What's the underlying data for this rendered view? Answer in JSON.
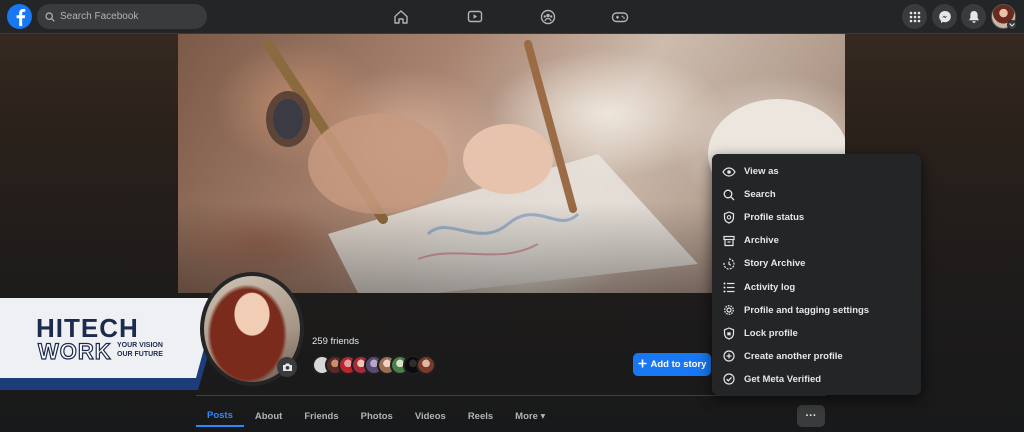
{
  "topbar": {
    "search_placeholder": "Search Facebook",
    "icons": [
      "facebook-logo",
      "search-icon",
      "home-icon",
      "video-icon",
      "groups-icon",
      "gaming-icon",
      "menu-grid-icon",
      "messenger-icon",
      "notifications-icon"
    ]
  },
  "profile": {
    "friends_count": "259 friends",
    "add_story_label": "Add to story"
  },
  "tabs": [
    {
      "label": "Posts",
      "active": true
    },
    {
      "label": "About"
    },
    {
      "label": "Friends"
    },
    {
      "label": "Photos"
    },
    {
      "label": "Videos"
    },
    {
      "label": "Reels"
    },
    {
      "label": "More ▾"
    }
  ],
  "more_button_label": "···",
  "menu": {
    "items": [
      {
        "label": "View as",
        "icon": "eye-icon"
      },
      {
        "label": "Search",
        "icon": "search-icon"
      },
      {
        "label": "Profile status",
        "icon": "shield-icon"
      },
      {
        "label": "Archive",
        "icon": "archive-icon"
      },
      {
        "label": "Story Archive",
        "icon": "story-archive-icon"
      },
      {
        "label": "Activity log",
        "icon": "list-icon"
      },
      {
        "label": "Profile and tagging settings",
        "icon": "gear-icon"
      },
      {
        "label": "Lock profile",
        "icon": "lock-shield-icon"
      },
      {
        "label": "Create another profile",
        "icon": "plus-circle-icon"
      },
      {
        "label": "Get Meta Verified",
        "icon": "verified-badge-icon"
      }
    ]
  },
  "watermark": {
    "brand_top": "HITECH",
    "brand_bottom": "WORK",
    "tagline_1": "YOUR VISION",
    "tagline_2": "OUR FUTURE"
  },
  "colors": {
    "accent": "#1877f2",
    "active_tab": "#2d88ff",
    "surface": "#242526",
    "page_bg": "#18191a"
  }
}
